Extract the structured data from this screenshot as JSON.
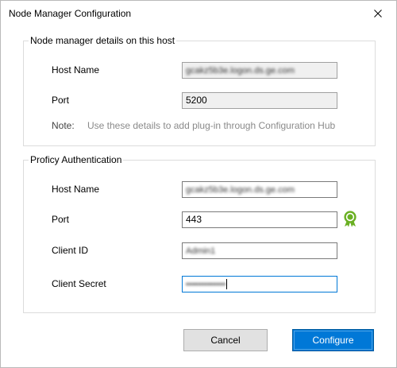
{
  "window": {
    "title": "Node Manager Configuration"
  },
  "node_manager": {
    "group_title": "Node manager details on this host",
    "host_name_label": "Host Name",
    "host_name_value": "gcakz5b3e.logon.ds.ge.com",
    "port_label": "Port",
    "port_value": "5200",
    "note_label": "Note:",
    "note_text": "Use these details to add plug-in through Configuration Hub"
  },
  "proficy": {
    "group_title": "Proficy Authentication",
    "host_name_label": "Host Name",
    "host_name_value": "gcakz5b3e.logon.ds.ge.com",
    "port_label": "Port",
    "port_value": "443",
    "client_id_label": "Client ID",
    "client_id_value": "Admin1",
    "client_secret_label": "Client Secret",
    "client_secret_value": "•••••••••••••"
  },
  "buttons": {
    "cancel": "Cancel",
    "configure": "Configure"
  },
  "icons": {
    "close": "close-icon",
    "certificate": "certificate-badge-icon"
  },
  "colors": {
    "accent": "#0078d7",
    "certificate": "#6ab023"
  }
}
